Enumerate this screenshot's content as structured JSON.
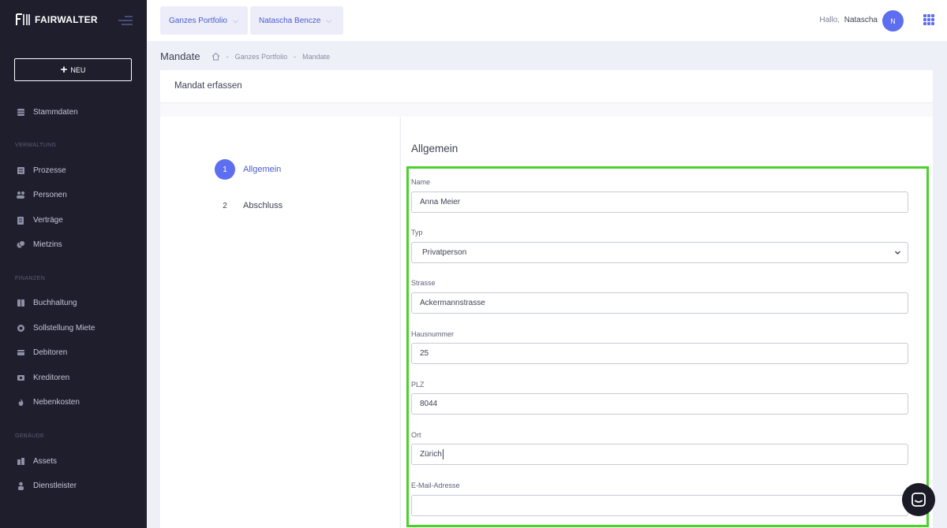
{
  "brand": {
    "logo_text": "FAIRWALTER"
  },
  "sidebar": {
    "new_label": "NEU",
    "top_item": {
      "label": "Stammdaten",
      "icon": "database-icon"
    },
    "sections": [
      {
        "title": "VERWALTUNG",
        "items": [
          {
            "label": "Prozesse",
            "icon": "list-icon"
          },
          {
            "label": "Personen",
            "icon": "people-icon"
          },
          {
            "label": "Verträge",
            "icon": "contract-icon"
          },
          {
            "label": "Mietzins",
            "icon": "coins-icon"
          }
        ]
      },
      {
        "title": "FINANZEN",
        "items": [
          {
            "label": "Buchhaltung",
            "icon": "ledger-icon"
          },
          {
            "label": "Sollstellung Miete",
            "icon": "receivables-icon"
          },
          {
            "label": "Debitoren",
            "icon": "debtors-icon"
          },
          {
            "label": "Kreditoren",
            "icon": "creditors-icon"
          },
          {
            "label": "Nebenkosten",
            "icon": "fire-icon"
          }
        ]
      },
      {
        "title": "GEBÄUDE",
        "items": [
          {
            "label": "Assets",
            "icon": "buildings-icon"
          },
          {
            "label": "Dienstleister",
            "icon": "service-person-icon"
          }
        ]
      }
    ]
  },
  "header": {
    "portfolio_dropdown": "Ganzes Portfolio",
    "user_dropdown": "Natascha Bencze",
    "greeting": "Hallo,",
    "user_name": "Natascha",
    "avatar_initial": "N"
  },
  "breadcrumb": {
    "page_title": "Mandate",
    "items": [
      "Ganzes Portfolio",
      "Mandate"
    ],
    "separator": "-"
  },
  "card": {
    "title": "Mandat erfassen",
    "steps": [
      {
        "number": "1",
        "label": "Allgemein",
        "active": true
      },
      {
        "number": "2",
        "label": "Abschluss",
        "active": false
      }
    ],
    "section_title": "Allgemein",
    "fields": {
      "name": {
        "label": "Name",
        "value": "Anna Meier"
      },
      "typ": {
        "label": "Typ",
        "value": "Privatperson"
      },
      "strasse": {
        "label": "Strasse",
        "value": "Ackermannstrasse"
      },
      "hausnummer": {
        "label": "Hausnummer",
        "value": "25"
      },
      "plz": {
        "label": "PLZ",
        "value": "8044"
      },
      "ort": {
        "label": "Ort",
        "value": "Zürich"
      },
      "email": {
        "label": "E-Mail-Adresse",
        "value": ""
      }
    }
  },
  "colors": {
    "sidebar_bg": "#1e1e2d",
    "accent": "#5d6ef0",
    "highlight_border": "#4cd12c"
  }
}
